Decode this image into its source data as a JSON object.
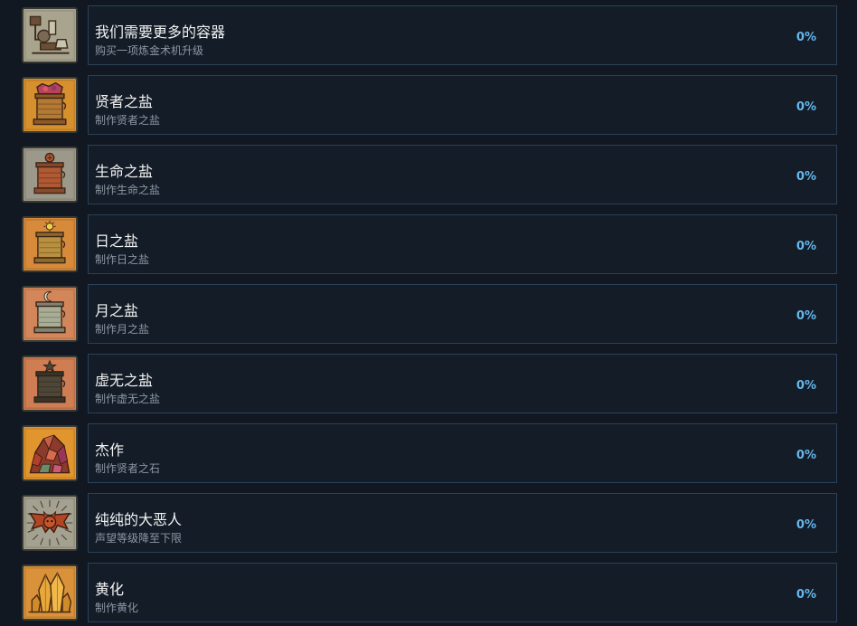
{
  "achievements": [
    {
      "title": "我们需要更多的容器",
      "description": "购买一项炼金术机升级",
      "percent": "0%",
      "icon": "alchemy-apparatus-icon",
      "bg": "#a8a48e",
      "accent": "#6b4e35"
    },
    {
      "title": "贤者之盐",
      "description": "制作贤者之盐",
      "percent": "0%",
      "icon": "sage-salt-jar-icon",
      "bg": "#d7902e",
      "accent": "#8e5a22"
    },
    {
      "title": "生命之盐",
      "description": "制作生命之盐",
      "percent": "0%",
      "icon": "life-salt-jar-icon",
      "bg": "#9c998a",
      "accent": "#b05a34"
    },
    {
      "title": "日之盐",
      "description": "制作日之盐",
      "percent": "0%",
      "icon": "sun-salt-jar-icon",
      "bg": "#d68a3a",
      "accent": "#a97f3a"
    },
    {
      "title": "月之盐",
      "description": "制作月之盐",
      "percent": "0%",
      "icon": "moon-salt-jar-icon",
      "bg": "#d2865a",
      "accent": "#a9ad95"
    },
    {
      "title": "虚无之盐",
      "description": "制作虚无之盐",
      "percent": "0%",
      "icon": "void-salt-jar-icon",
      "bg": "#cf7d52",
      "accent": "#4e4636"
    },
    {
      "title": "杰作",
      "description": "制作贤者之石",
      "percent": "0%",
      "icon": "gem-pile-icon",
      "bg": "#e1952e",
      "accent": "#b2402f"
    },
    {
      "title": "纯纯的大恶人",
      "description": "声望等级降至下限",
      "percent": "0%",
      "icon": "demon-bat-icon",
      "bg": "#a5a190",
      "accent": "#b24524"
    },
    {
      "title": "黄化",
      "description": "制作黄化",
      "percent": "0%",
      "icon": "crystal-cluster-icon",
      "bg": "#d9923a",
      "accent": "#c77a2a"
    }
  ]
}
